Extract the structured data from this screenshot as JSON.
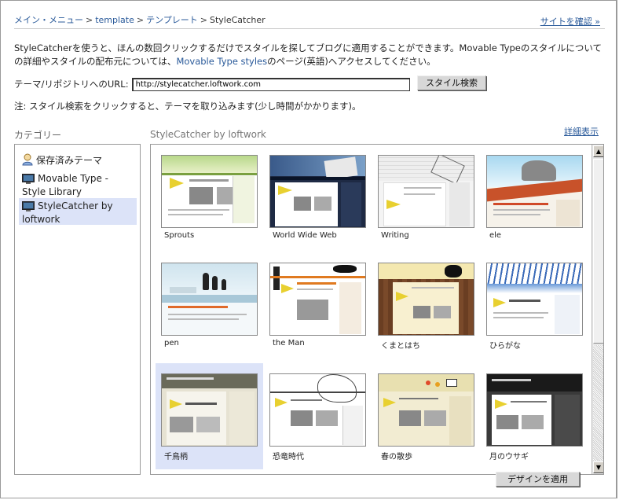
{
  "breadcrumb": {
    "items": [
      "メイン・メニュー",
      "template",
      "テンプレート"
    ],
    "separator": ">",
    "current": "StyleCatcher"
  },
  "header": {
    "view_site": "サイトを確認 »"
  },
  "intro": {
    "text1": "StyleCatcherを使うと、ほんの数回クリックするだけでスタイルを探してブログに適用することができます。Movable Typeのスタイルについての詳細やスタイルの配布元については、",
    "link": "Movable Type styles",
    "text2": "のページ(英語)へアクセスしてください。"
  },
  "url_form": {
    "label": "テーマ/リポジトリへのURL:",
    "value": "http://stylecatcher.loftwork.com",
    "search_button": "スタイル検索"
  },
  "note": "注: スタイル検索をクリックすると、テーマを取り込みます(少し時間がかかります)。",
  "categories": {
    "title": "カテゴリー",
    "items": [
      {
        "label": "保存済みテーマ",
        "icon": "user-icon",
        "selected": false
      },
      {
        "label": "Movable Type - Style Library",
        "icon": "monitor-icon",
        "selected": false
      },
      {
        "label": "StyleCatcher by loftwork",
        "icon": "monitor-icon",
        "selected": true
      }
    ]
  },
  "themes": {
    "title": "StyleCatcher by loftwork",
    "detail_link": "詳細表示",
    "items": [
      {
        "name": "Sprouts",
        "selected": false
      },
      {
        "name": "World Wide Web",
        "selected": false
      },
      {
        "name": "Writing",
        "selected": false
      },
      {
        "name": "ele",
        "selected": false
      },
      {
        "name": "pen",
        "selected": false
      },
      {
        "name": "the Man",
        "selected": false
      },
      {
        "name": "くまとはち",
        "selected": false
      },
      {
        "name": "ひらがな",
        "selected": false
      },
      {
        "name": "千鳥柄",
        "selected": true
      },
      {
        "name": "恐竜時代",
        "selected": false
      },
      {
        "name": "春の散歩",
        "selected": false
      },
      {
        "name": "月のウサギ",
        "selected": false
      }
    ]
  },
  "actions": {
    "apply_button": "デザインを適用"
  },
  "colors": {
    "link": "#2a5a9a",
    "selection": "#dce3f8"
  }
}
